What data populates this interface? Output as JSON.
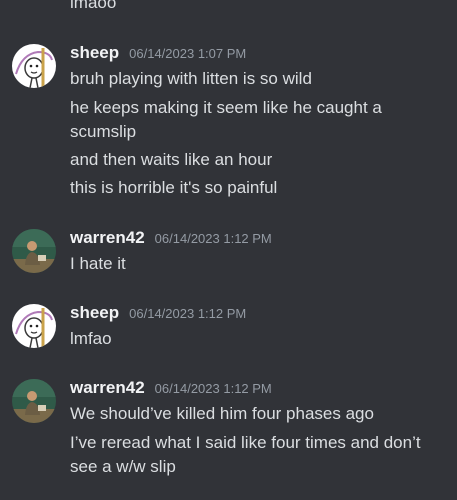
{
  "channel": {
    "top_partial_line": "lmaoo",
    "messages": [
      {
        "user": "sheep",
        "time": "06/14/2023 1:07 PM",
        "avatar_icon": "sheep-avatar-icon",
        "lines": [
          "bruh playing with litten is so wild",
          "he keeps making it seem like he caught a scumslip",
          "and then waits like an hour",
          "this is horrible it's so painful"
        ]
      },
      {
        "user": "warren42",
        "time": "06/14/2023 1:12 PM",
        "avatar_icon": "warren-avatar-icon",
        "lines": [
          "I hate it"
        ]
      },
      {
        "user": "sheep",
        "time": "06/14/2023 1:12 PM",
        "avatar_icon": "sheep-avatar-icon",
        "lines": [
          "lmfao"
        ]
      },
      {
        "user": "warren42",
        "time": "06/14/2023 1:12 PM",
        "avatar_icon": "warren-avatar-icon",
        "lines": [
          "We should’ve killed him four phases ago",
          "I’ve reread what I said like four times and don’t see a w/w slip"
        ]
      }
    ]
  },
  "colors": {
    "background": "#313338",
    "username": "#f2f3f5",
    "message_text": "#dbdee1",
    "timestamp": "#949ba4"
  }
}
